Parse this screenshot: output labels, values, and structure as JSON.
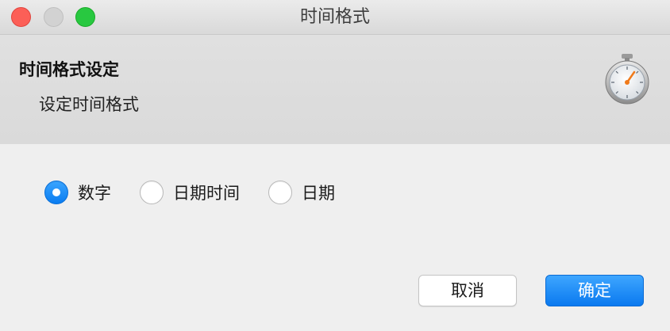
{
  "window": {
    "title": "时间格式"
  },
  "header": {
    "title": "时间格式设定",
    "subtitle": "设定时间格式",
    "icon": "stopwatch-icon"
  },
  "format_options": {
    "selected": "数字",
    "options": [
      {
        "label": "数字",
        "checked": true
      },
      {
        "label": "日期时间",
        "checked": false
      },
      {
        "label": "日期",
        "checked": false
      }
    ]
  },
  "buttons": {
    "cancel_label": "取消",
    "ok_label": "确定"
  },
  "colors": {
    "accent": "#0a7cf0",
    "close": "#fc5f57",
    "minimize_disabled": "#d2d2d2",
    "maximize": "#28c840"
  }
}
